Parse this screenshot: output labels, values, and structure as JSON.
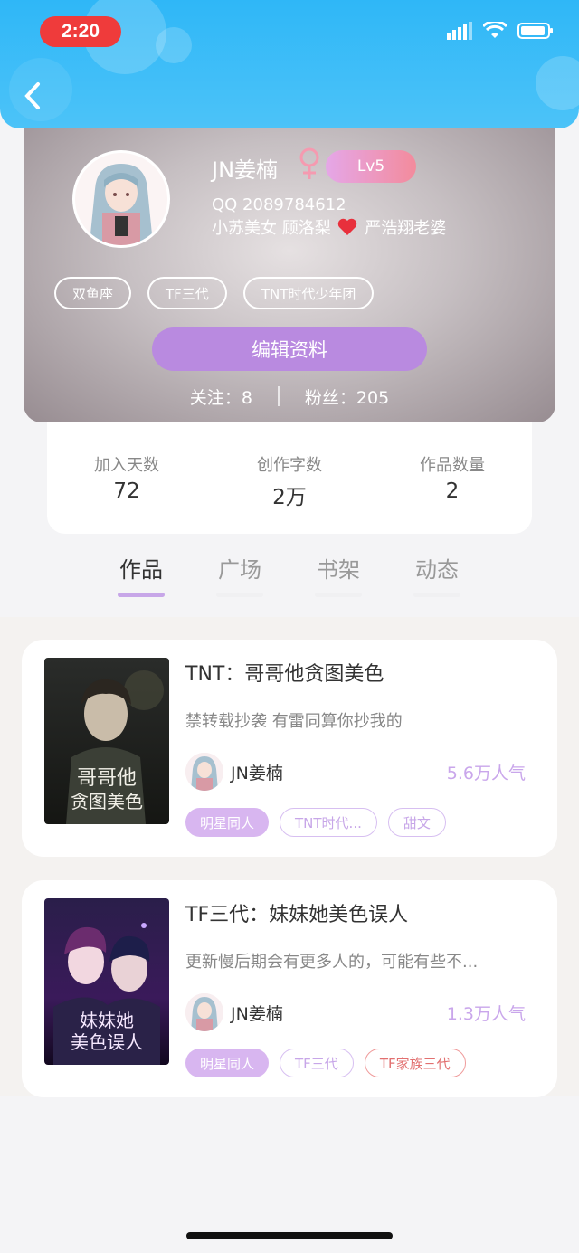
{
  "status_bar": {
    "time": "2:20"
  },
  "profile": {
    "name": "JN姜楠",
    "level": "Lv5",
    "qq": "QQ 2089784612",
    "signature_before": "小苏美女 顾洛梨",
    "signature_after": "严浩翔老婆",
    "tags": [
      "双鱼座",
      "TF三代",
      "TNT时代少年团"
    ],
    "edit_button": "编辑资料",
    "following_label": "关注：",
    "following": "8",
    "fans_label": "粉丝：",
    "fans": "205"
  },
  "stats": [
    {
      "label": "加入天数",
      "value": "72"
    },
    {
      "label": "创作字数",
      "value": "2万"
    },
    {
      "label": "作品数量",
      "value": "2"
    }
  ],
  "tabs": [
    {
      "label": "作品",
      "active": true
    },
    {
      "label": "广场",
      "active": false
    },
    {
      "label": "书架",
      "active": false
    },
    {
      "label": "动态",
      "active": false
    }
  ],
  "works": [
    {
      "title": "TNT：哥哥他贪图美色",
      "description": "禁转载抄袭 有雷同算你抄我的",
      "author": "JN姜楠",
      "popularity": "5.6万人气",
      "cover_text": "哥哥他贪图美色",
      "tags": [
        "明星同人",
        "TNT时代...",
        "甜文"
      ]
    },
    {
      "title": "TF三代：妹妹她美色误人",
      "description": "更新慢后期会有更多人的，可能有些不...",
      "author": "JN姜楠",
      "popularity": "1.3万人气",
      "cover_text": "妹妹她美色误人",
      "tags": [
        "明星同人",
        "TF三代",
        "TF家族三代"
      ]
    }
  ]
}
